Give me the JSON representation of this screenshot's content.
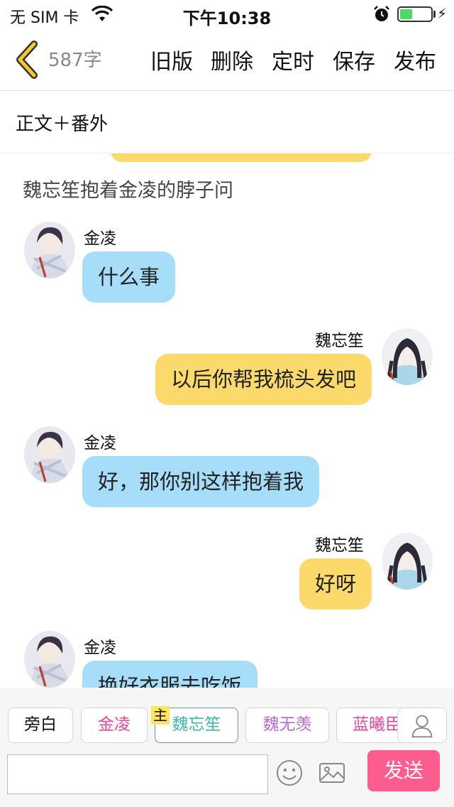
{
  "status_bar": {
    "carrier": "无 SIM 卡",
    "time": "下午10:38",
    "battery_level": 0.4
  },
  "header": {
    "word_count": "587字",
    "buttons": [
      "旧版",
      "删除",
      "定时",
      "保存",
      "发布"
    ]
  },
  "chapter": {
    "title": "正文＋番外"
  },
  "chat": {
    "narration": "魏忘笙抱着金凌的脖子问",
    "messages": [
      {
        "speaker": "金凌",
        "side": "left",
        "text": "什么事"
      },
      {
        "speaker": "魏忘笙",
        "side": "right",
        "text": "以后你帮我梳头发吧"
      },
      {
        "speaker": "金凌",
        "side": "left",
        "text": "好，那你别这样抱着我"
      },
      {
        "speaker": "魏忘笙",
        "side": "right",
        "text": "好呀"
      },
      {
        "speaker": "金凌",
        "side": "left",
        "text": "换好衣服去吃饭"
      }
    ]
  },
  "characters": {
    "main_badge": "主",
    "chips": [
      {
        "label": "旁白",
        "color": "#111111"
      },
      {
        "label": "金凌",
        "color": "#e5479a"
      },
      {
        "label": "魏忘笙",
        "color": "#3fb8b0"
      },
      {
        "label": "魏无羡",
        "color": "#b56fd0"
      },
      {
        "label": "蓝曦臣",
        "color": "#e5479a"
      }
    ]
  },
  "input": {
    "placeholder": "",
    "send_label": "发送"
  },
  "colors": {
    "left_bubble": "#a6ddf8",
    "right_bubble": "#fbd96b",
    "send_button": "#fc5c8e",
    "back_arrow": "#f3c92e"
  }
}
